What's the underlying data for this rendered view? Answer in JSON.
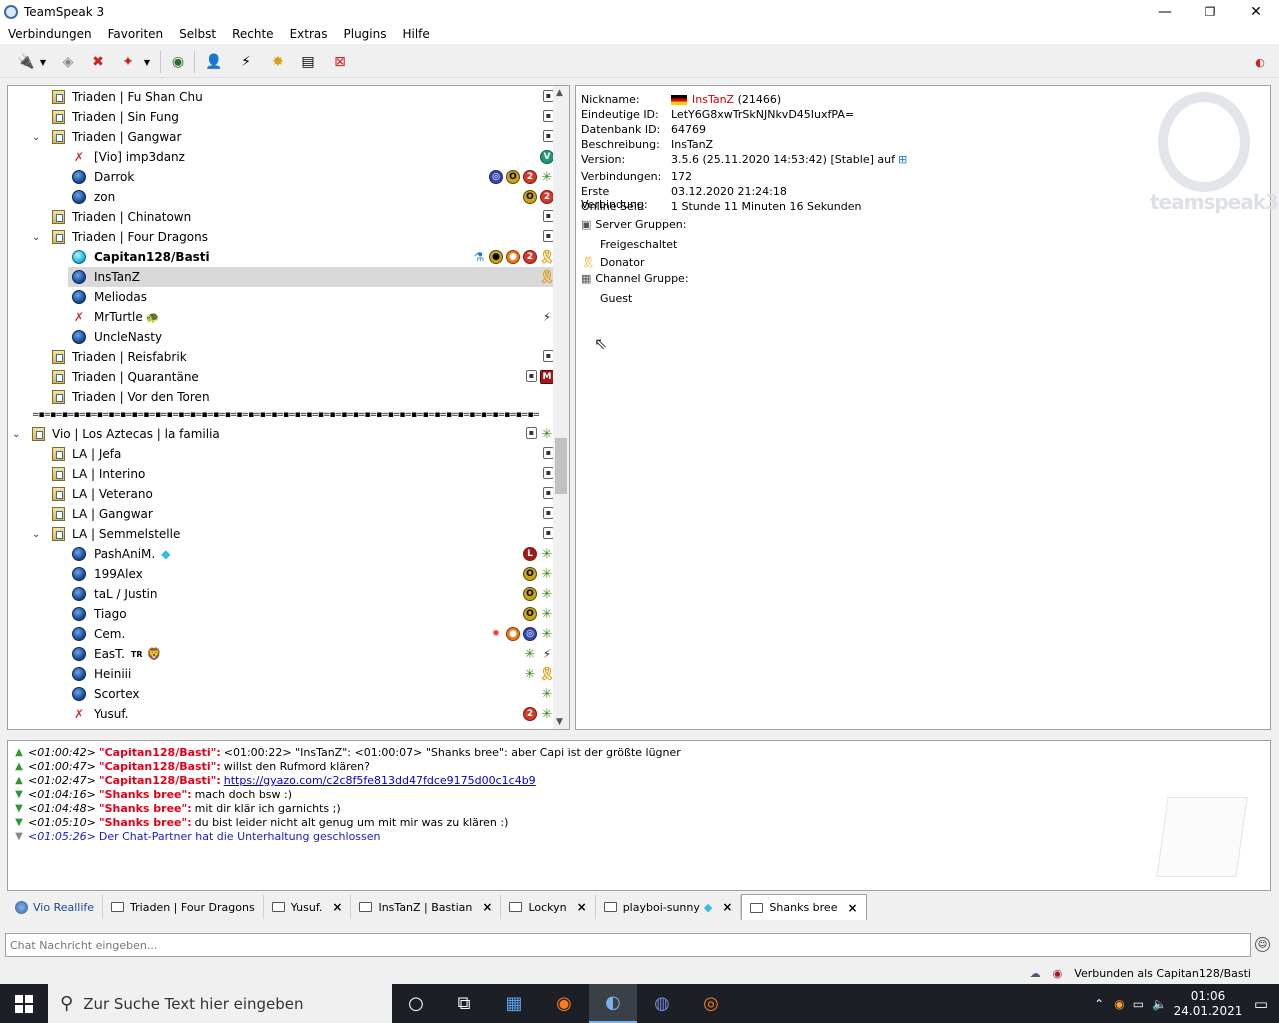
{
  "window": {
    "title": "TeamSpeak 3",
    "minimize": "—",
    "restore": "❐",
    "close": "✕"
  },
  "menu": [
    "Verbindungen",
    "Favoriten",
    "Selbst",
    "Rechte",
    "Extras",
    "Plugins",
    "Hilfe"
  ],
  "tree": {
    "rows": [
      {
        "label": "Triaden | Fu Shan Chu"
      },
      {
        "label": "Triaden | Sin Fung"
      },
      {
        "label": "Triaden | Gangwar"
      },
      {
        "label": "[Vio] imp3danz"
      },
      {
        "label": "Darrok"
      },
      {
        "label": "zon"
      },
      {
        "label": "Triaden | Chinatown"
      },
      {
        "label": "Triaden | Four Dragons"
      },
      {
        "label": "Capitan128/Basti"
      },
      {
        "label": "InsTanZ"
      },
      {
        "label": "Meliodas"
      },
      {
        "label": "MrTurtle"
      },
      {
        "label": "UncleNasty"
      },
      {
        "label": "Triaden | Reisfabrik"
      },
      {
        "label": "Triaden | Quarantäne"
      },
      {
        "label": "Triaden | Vor den Toren"
      },
      {
        "label": "=▪=▪=▪=▪=▪=▪=▪=▪=▪=▪=▪=▪=▪=▪=▪=▪=▪=▪=▪=▪=▪=▪=▪=▪=▪=▪=▪=▪=▪=▪=▪=▪=▪=▪=▪=▪=▪=▪=▪=▪=▪=▪=▪="
      },
      {
        "label": "Vio | Los Aztecas | la familia"
      },
      {
        "label": "LA | Jefa"
      },
      {
        "label": "LA | Interino"
      },
      {
        "label": "LA | Veterano"
      },
      {
        "label": "LA | Gangwar"
      },
      {
        "label": "LA | Semmelstelle"
      },
      {
        "label": "PashAniM."
      },
      {
        "label": "199Alex"
      },
      {
        "label": "taL / Justin"
      },
      {
        "label": "Tiago"
      },
      {
        "label": "Cem."
      },
      {
        "label": "EasT."
      },
      {
        "label": "Heiniii"
      },
      {
        "label": "Scortex"
      },
      {
        "label": "Yusuf."
      }
    ],
    "east_tag": "TR"
  },
  "info": {
    "nickname_label": "Nickname:",
    "nickname": "InsTanZ",
    "nickname_id": "(21466)",
    "uid_label": "Eindeutige ID:",
    "uid": "LetY6G8xwTrSkNJNkvD45IuxfPA=",
    "dbid_label": "Datenbank ID:",
    "dbid": "64769",
    "desc_label": "Beschreibung:",
    "desc": "InsTanZ",
    "version_label": "Version:",
    "version": "3.5.6 (25.11.2020 14:53:42) [Stable] auf",
    "connections_label": "Verbindungen:",
    "connections": "172",
    "first_label": "Erste Verbindung:",
    "first": "03.12.2020 21:24:18",
    "online_label": "Online Seit:",
    "online": "1 Stunde 11 Minuten 16 Sekunden",
    "server_groups_label": "Server Gruppen:",
    "server_groups": [
      "Freigeschaltet",
      "Donator"
    ],
    "channel_group_label": "Channel Gruppe:",
    "channel_group": "Guest",
    "watermark": "teamspeak3"
  },
  "chat": {
    "lines": [
      {
        "time": "<01:00:42>",
        "nick": "\"Capitan128/Basti\":",
        "msg": "<01:00:22> \"InsTanZ\": <01:00:07> \"Shanks bree\": aber Capi ist der größte lügner"
      },
      {
        "time": "<01:00:47>",
        "nick": "\"Capitan128/Basti\":",
        "msg": "willst den Rufmord klären?"
      },
      {
        "time": "<01:02:47>",
        "nick": "\"Capitan128/Basti\":",
        "msg": "https://gyazo.com/c2c8f5fe813dd47fdce9175d00c1c4b9"
      },
      {
        "time": "<01:04:16>",
        "nick": "\"Shanks bree\":",
        "msg": "mach doch bsw :)"
      },
      {
        "time": "<01:04:48>",
        "nick": "\"Shanks bree\":",
        "msg": "mit dir klär ich garnichts ;)"
      },
      {
        "time": "<01:05:10>",
        "nick": "\"Shanks bree\":",
        "msg": "du bist leider nicht alt genug um mit mir was zu klären :)"
      },
      {
        "time": "<01:05:26>",
        "nick": "",
        "msg": "Der Chat-Partner hat die Unterhaltung geschlossen"
      }
    ]
  },
  "tabs": [
    "Vio Reallife",
    "Triaden | Four Dragons",
    "Yusuf.",
    "InsTanZ | Bastian",
    "Lockyn",
    "playboi-sunny",
    "Shanks bree"
  ],
  "input": {
    "placeholder": "Chat Nachricht eingeben..."
  },
  "status": {
    "text": "Verbunden als Capitan128/Basti"
  },
  "taskbar": {
    "search_placeholder": "Zur Suche Text hier eingeben",
    "time": "01:06",
    "date": "24.01.2021"
  }
}
